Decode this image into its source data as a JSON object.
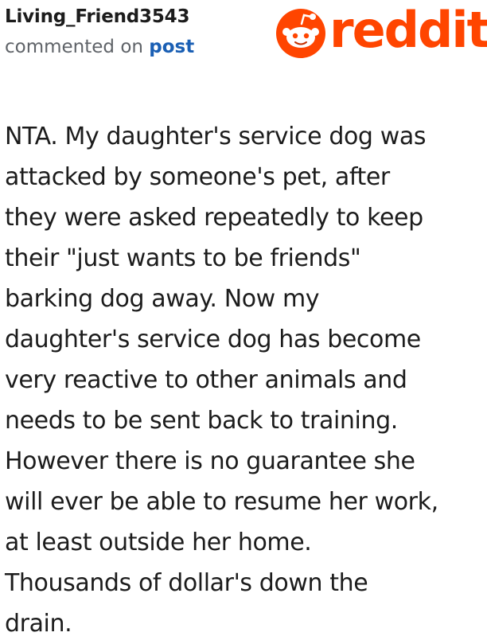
{
  "header": {
    "username": "Living_Friend3543",
    "action_text": "commented on",
    "post_link_label": "post",
    "brand": {
      "icon": "reddit-snoo-icon",
      "wordmark": "reddit",
      "color": "#ff4500"
    }
  },
  "comment": {
    "lines": [
      "NTA. My daughter's service dog was",
      "attacked by someone's pet, after",
      "they were asked repeatedly to keep",
      "their \"just wants to be friends\"",
      "barking dog away. Now my",
      "daughter's service dog has become",
      "very reactive to other animals and",
      "needs to be sent back to training.",
      "However there is no guarantee she",
      "will ever be able to resume her work,",
      "at least outside her home.",
      "Thousands of dollar's down the",
      "drain."
    ]
  }
}
